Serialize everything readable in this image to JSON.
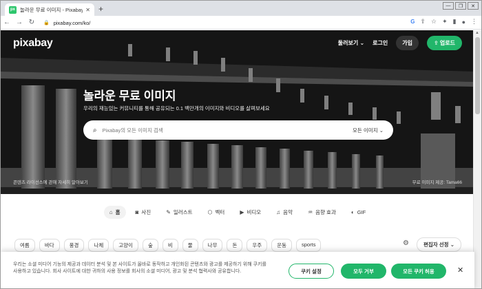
{
  "browser": {
    "tab_title": "놀라운 무료 이미지 - Pixabay -",
    "favicon_text": "px",
    "url": "pixabay.com/ko/",
    "window_buttons": [
      "—",
      "❐",
      "✕"
    ]
  },
  "hero": {
    "logo": "pixabay",
    "nav": {
      "explore": "둘러보기",
      "login": "로그인",
      "join": "가입",
      "upload": "업로드"
    },
    "title": "놀라운 무료 이미지",
    "subtitle": "우리의 재능있는 커뮤니티를 통해 공유되는 0.1 백만개의 이미지와 비디오를 살펴보세요",
    "search_placeholder": "Pixabay의 모든 이미지 검색",
    "search_scope": "모든 이미지",
    "license_note": "콘텐츠 라이선스에 관해 자세히 알아보기",
    "credit_note": "무료 이미지 제공: Tama66"
  },
  "categories": [
    {
      "label": "홈",
      "icon": "⌂",
      "active": true
    },
    {
      "label": "사진",
      "icon": "◙",
      "active": false
    },
    {
      "label": "일러스트",
      "icon": "✎",
      "active": false
    },
    {
      "label": "벡터",
      "icon": "⬡",
      "active": false
    },
    {
      "label": "비디오",
      "icon": "▶",
      "active": false
    },
    {
      "label": "음악",
      "icon": "♫",
      "active": false
    },
    {
      "label": "음향 효과",
      "icon": "♒",
      "active": false
    },
    {
      "label": "GIF",
      "icon": "◐",
      "active": false
    }
  ],
  "tags": [
    "여름",
    "바다",
    "풍경",
    "나체",
    "고양이",
    "숲",
    "비",
    "물",
    "나무",
    "돈",
    "우주",
    "운동",
    "sports"
  ],
  "editor_pick": "편집자 선정",
  "cookie": {
    "text": "우리는 소셜 미디어 기능의 제공과 데이터 분석 및 본 사이트가 올바로 동작하고 개인화된 콘텐츠와 광고를 제공하기 위해 쿠키를 사용하고 있습니다. 회사 사이트에 대한 귀하의 사용 정보를 회사의 소셜 미디어, 광고 및 분석 협력사와 공유합니다.",
    "settings": "쿠키 설정",
    "reject": "모두 거부",
    "accept": "모든 쿠키 허용"
  },
  "colors": {
    "brand_green": "#21b66a"
  }
}
